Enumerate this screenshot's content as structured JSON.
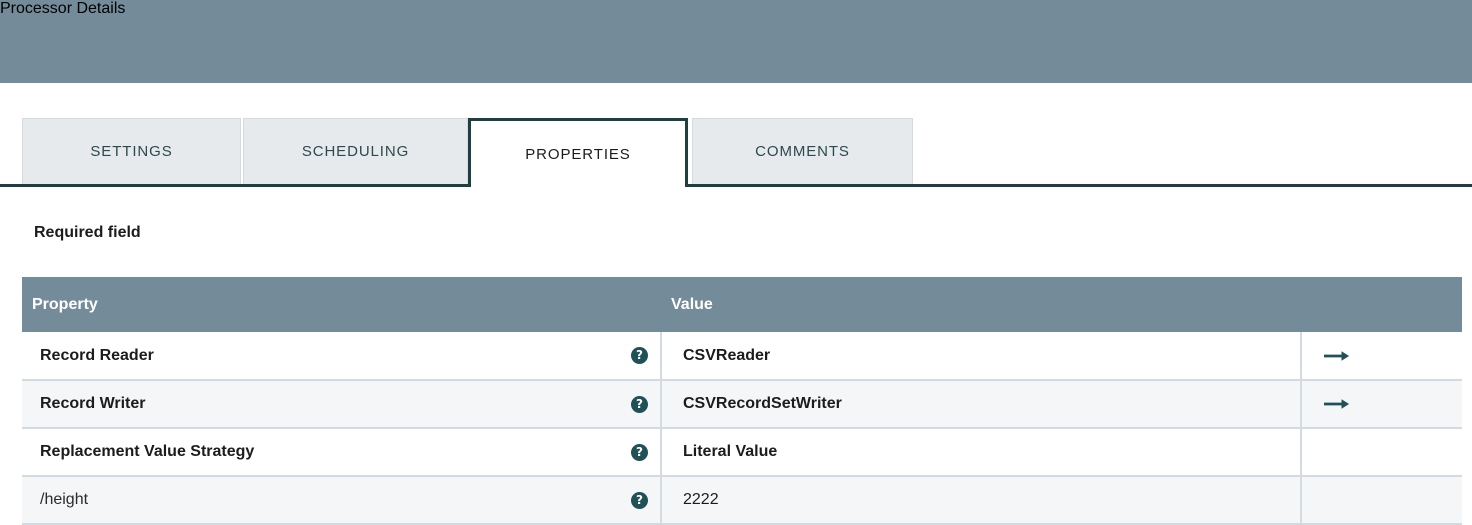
{
  "header": {
    "title": "Processor Details",
    "bg_color": "#748b99"
  },
  "tabs": [
    {
      "label": "SETTINGS",
      "active": false
    },
    {
      "label": "SCHEDULING",
      "active": false
    },
    {
      "label": "PROPERTIES",
      "active": true
    },
    {
      "label": "COMMENTS",
      "active": false
    }
  ],
  "legend": {
    "required_field_label": "Required field"
  },
  "table": {
    "columns": [
      "Property",
      "Value",
      ""
    ],
    "accent_color": "#748b99",
    "icon_color": "#1f5157",
    "rows": [
      {
        "property": "Record Reader",
        "required": true,
        "help_icon": "help-circle-icon",
        "value": "CSVReader",
        "value_strong": true,
        "go_icon": "arrow-right-icon",
        "has_go": true
      },
      {
        "property": "Record Writer",
        "required": true,
        "help_icon": "help-circle-icon",
        "value": "CSVRecordSetWriter",
        "value_strong": true,
        "go_icon": "arrow-right-icon",
        "has_go": true
      },
      {
        "property": "Replacement Value Strategy",
        "required": true,
        "help_icon": "help-circle-icon",
        "value": "Literal Value",
        "value_strong": true,
        "go_icon": "arrow-right-icon",
        "has_go": false
      },
      {
        "property": "/height",
        "required": false,
        "help_icon": "help-circle-icon",
        "value": "2222",
        "value_strong": false,
        "go_icon": "arrow-right-icon",
        "has_go": false
      }
    ]
  },
  "help_glyph": "?"
}
